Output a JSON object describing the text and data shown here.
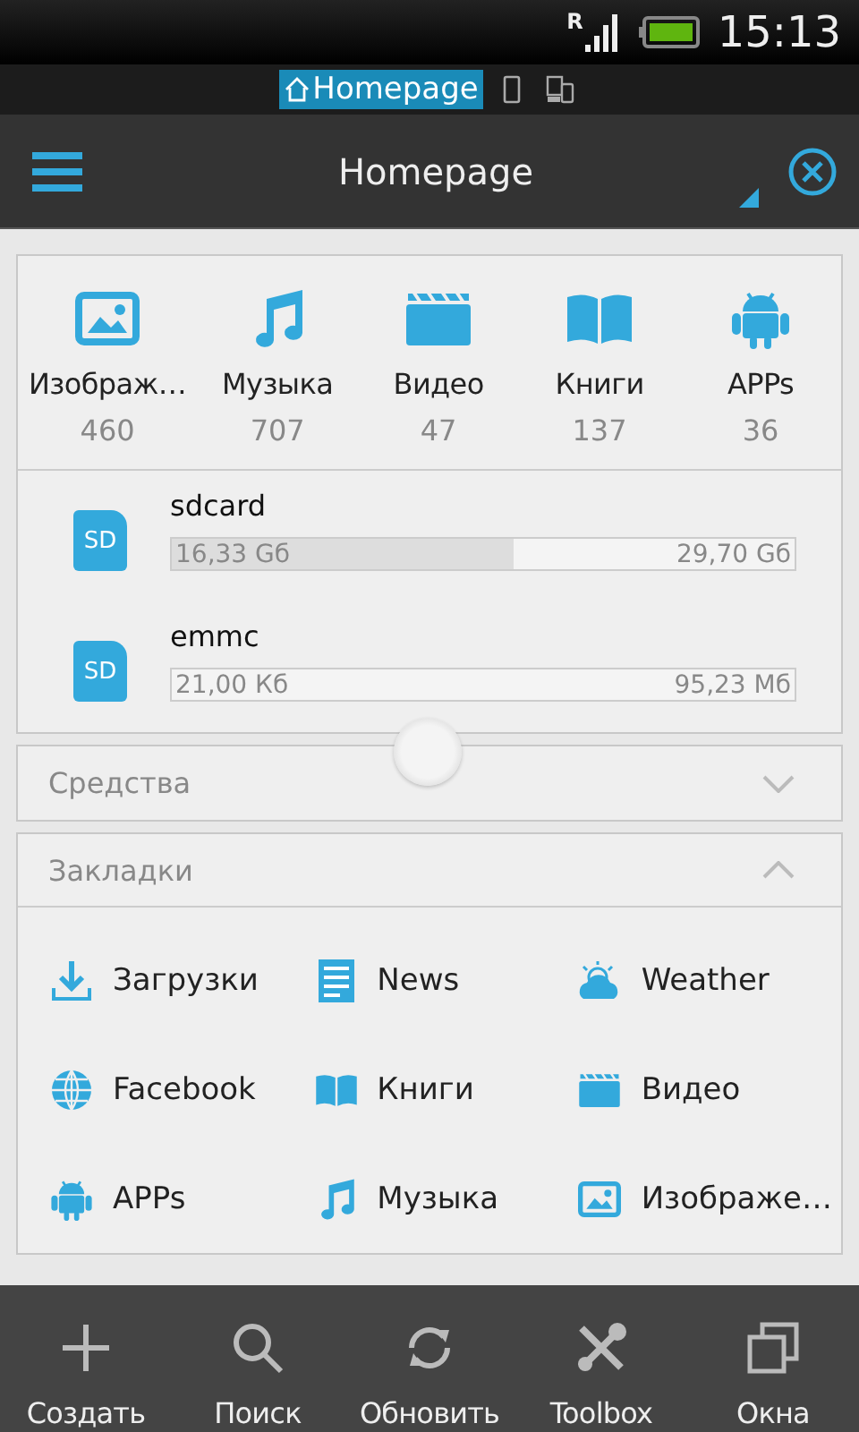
{
  "status_bar": {
    "roaming": "R",
    "time": "15:13"
  },
  "location_tabs": [
    {
      "kind": "home",
      "label": "Homepage",
      "selected": true
    },
    {
      "kind": "device",
      "selected": false
    },
    {
      "kind": "network",
      "selected": false
    }
  ],
  "title_bar": {
    "title": "Homepage"
  },
  "categories": [
    {
      "kind": "image",
      "label": "Изображ…",
      "count": "460"
    },
    {
      "kind": "music",
      "label": "Музыка",
      "count": "707"
    },
    {
      "kind": "video",
      "label": "Видео",
      "count": "47"
    },
    {
      "kind": "book",
      "label": "Книги",
      "count": "137"
    },
    {
      "kind": "app",
      "label": "APPs",
      "count": "36"
    }
  ],
  "storage": [
    {
      "name": "sdcard",
      "icon": "SD",
      "used": "16,33 Gб",
      "total": "29,70 Gб",
      "level": 0.55
    },
    {
      "name": "emmc",
      "icon": "SD",
      "used": "21,00 Кб",
      "total": "95,23 Мб",
      "level": 0
    }
  ],
  "panels": [
    {
      "title": "Средства",
      "expanded": false
    },
    {
      "title": "Закладки",
      "expanded": true
    }
  ],
  "bookmarks": [
    {
      "kind": "download",
      "label": "Загрузки"
    },
    {
      "kind": "news",
      "label": "News"
    },
    {
      "kind": "weather",
      "label": "Weather"
    },
    {
      "kind": "globe",
      "label": "Facebook"
    },
    {
      "kind": "book",
      "label": "Книги"
    },
    {
      "kind": "video",
      "label": "Видео"
    },
    {
      "kind": "app",
      "label": "APPs"
    },
    {
      "kind": "music",
      "label": "Музыка"
    },
    {
      "kind": "image",
      "label": "Изображе…"
    }
  ],
  "toolbar": [
    {
      "kind": "plus",
      "label": "Создать"
    },
    {
      "kind": "search",
      "label": "Поиск"
    },
    {
      "kind": "refresh",
      "label": "Обновить"
    },
    {
      "kind": "tools",
      "label": "Toolbox"
    },
    {
      "kind": "windows",
      "label": "Окна"
    }
  ]
}
